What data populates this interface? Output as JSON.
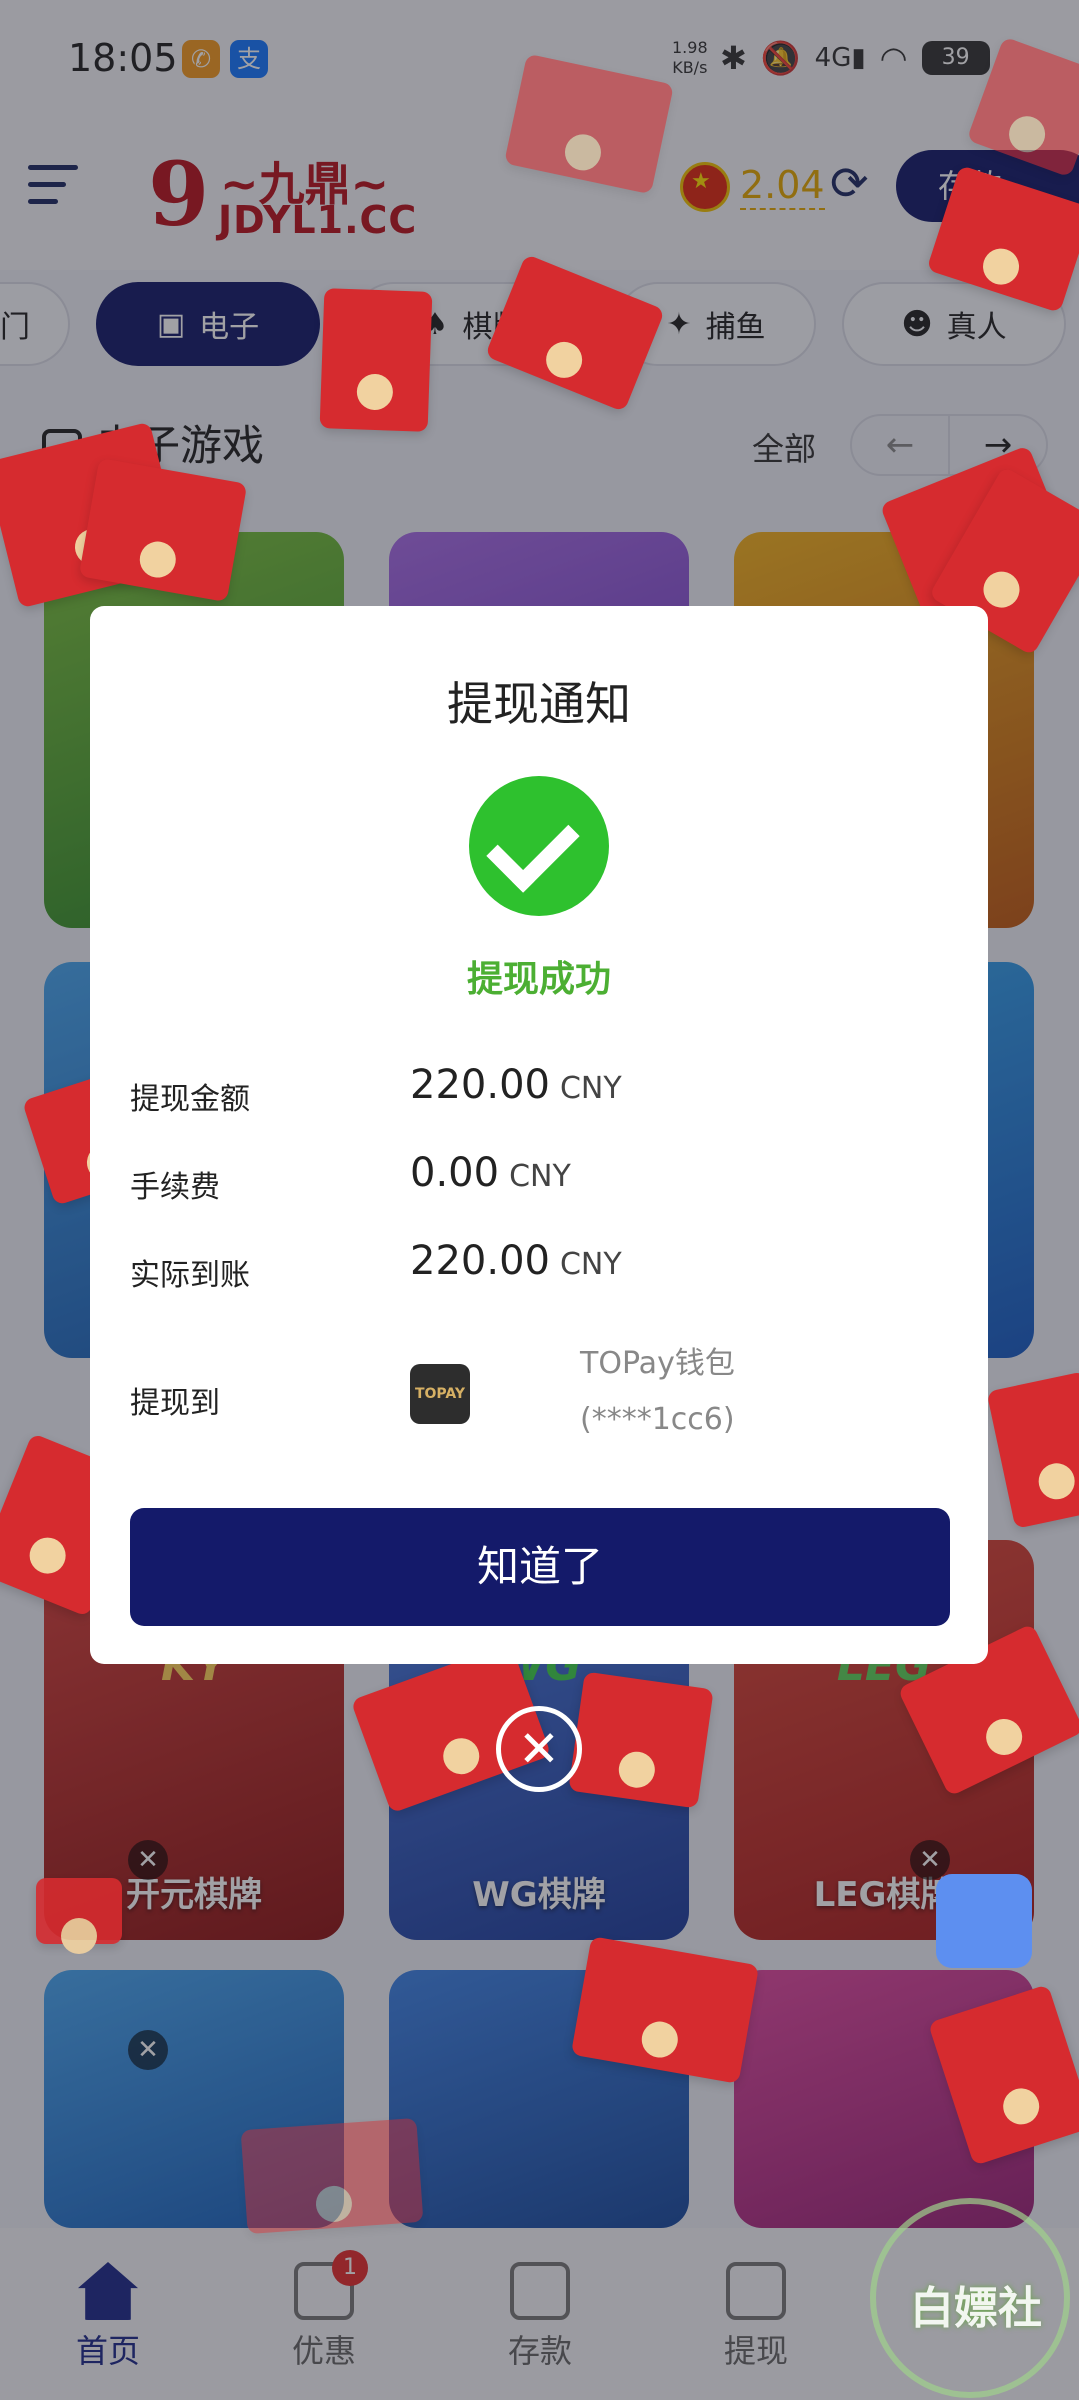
{
  "status_bar": {
    "time": "18:05",
    "net_speed_value": "1.98",
    "net_speed_unit": "KB/s",
    "network": "4G",
    "battery": "39",
    "icons": [
      "bluetooth-icon",
      "mute-icon",
      "signal-icon",
      "wifi-icon"
    ]
  },
  "header": {
    "logo_cn": "~九鼎~",
    "logo_url": "JDYL1.CC",
    "balance": "2.04",
    "deposit_label": "存款"
  },
  "tabs": [
    {
      "label": "门"
    },
    {
      "label": "电子"
    },
    {
      "label": "棋牌"
    },
    {
      "label": "捕鱼"
    },
    {
      "label": "真人"
    }
  ],
  "section": {
    "title": "电子游戏",
    "see_all": "全部",
    "prev": "←",
    "next": "→"
  },
  "games": [
    {
      "name": "开元棋牌",
      "badge": "KY"
    },
    {
      "name": "WG棋牌",
      "badge": "WG"
    },
    {
      "name": "LEG棋牌",
      "badge": "LEG"
    }
  ],
  "bottom_nav": [
    {
      "label": "首页",
      "badge": ""
    },
    {
      "label": "优惠",
      "badge": "1"
    },
    {
      "label": "存款",
      "badge": ""
    },
    {
      "label": "提现",
      "badge": ""
    }
  ],
  "modal": {
    "title": "提现通知",
    "status": "提现成功",
    "rows": [
      {
        "label": "提现金额",
        "value": "220.00",
        "unit": "CNY"
      },
      {
        "label": "手续费",
        "value": "0.00",
        "unit": "CNY"
      },
      {
        "label": "实际到账",
        "value": "220.00",
        "unit": "CNY"
      }
    ],
    "destination_label": "提现到",
    "wallet_logo": "TOPAY",
    "wallet_name": "TOPay钱包",
    "wallet_account": "(****1cc6)",
    "confirm": "知道了",
    "close": "✕"
  },
  "watermark": "白嫖社",
  "colors": {
    "primary": "#141a6a",
    "success": "#2ec12e",
    "success_text": "#4caf33",
    "balance": "#e3a700",
    "envelope": "#d62b2f"
  }
}
